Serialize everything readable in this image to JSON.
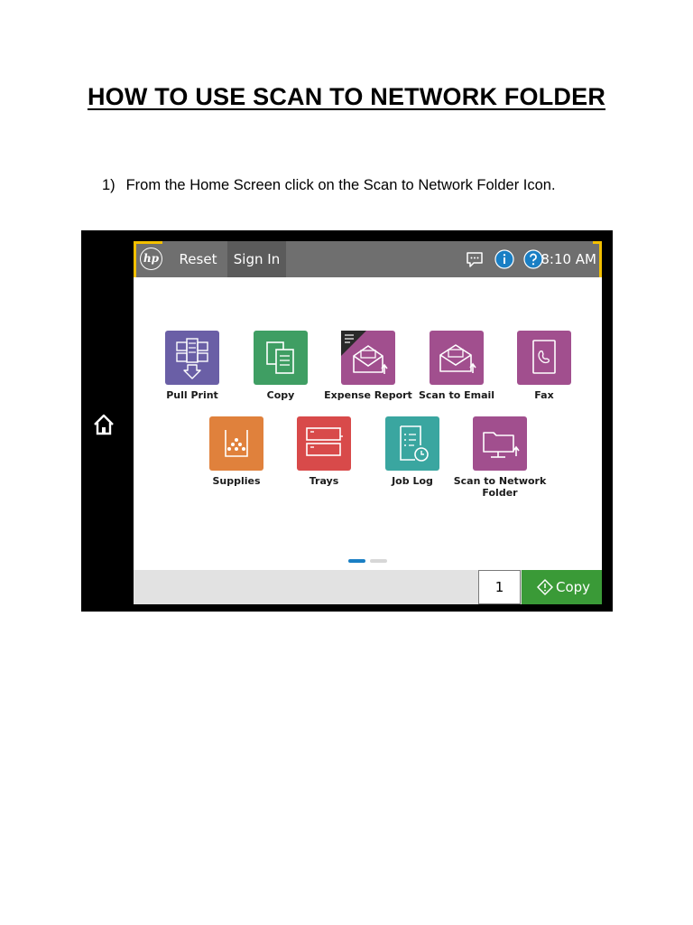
{
  "document": {
    "title": "HOW TO USE SCAN TO NETWORK FOLDER",
    "step_number": "1)",
    "step_text": "From the Home Screen click on the Scan to Network Folder Icon."
  },
  "screen": {
    "topbar": {
      "logo": "hp",
      "reset_label": "Reset",
      "signin_label": "Sign In",
      "time": "8:10 AM",
      "icons": [
        "message-icon",
        "info-icon",
        "help-icon"
      ]
    },
    "apps": [
      {
        "label": "Pull Print",
        "icon": "pull-print-icon",
        "color": "#6a5fa6"
      },
      {
        "label": "Copy",
        "icon": "copy-icon",
        "color": "#3f9e63"
      },
      {
        "label": "Expense Report",
        "icon": "expense-report-icon",
        "color": "#a14f8e"
      },
      {
        "label": "Scan to Email",
        "icon": "scan-to-email-icon",
        "color": "#a14f8e"
      },
      {
        "label": "Fax",
        "icon": "fax-icon",
        "color": "#a14f8e"
      },
      {
        "label": "Supplies",
        "icon": "supplies-icon",
        "color": "#e0813c"
      },
      {
        "label": "Trays",
        "icon": "trays-icon",
        "color": "#d84a4a"
      },
      {
        "label": "Job Log",
        "icon": "job-log-icon",
        "color": "#3aa6a0"
      },
      {
        "label": "Scan to Network Folder",
        "icon": "network-folder-icon",
        "color": "#a14f8e"
      }
    ],
    "pager": {
      "pages": 2,
      "active": 1,
      "active_color": "#1a7fc4",
      "inactive_color": "#d7d7d7"
    },
    "bottom": {
      "copies": "1",
      "copy_label": "Copy",
      "copy_color": "#3a9a37"
    }
  },
  "colors": {
    "highlight": "#f3c000",
    "topbar": "#6f6f6f",
    "bezel": "#000000"
  }
}
